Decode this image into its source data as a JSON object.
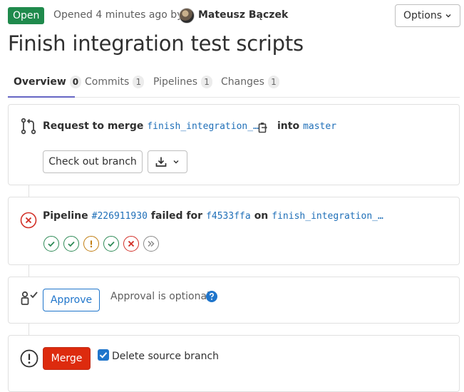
{
  "header": {
    "status": "Open",
    "opened_text": "Opened 4 minutes ago by",
    "author": "Mateusz Bączek",
    "options_label": "Options",
    "title": "Finish integration test scripts"
  },
  "tabs": [
    {
      "label": "Overview",
      "count": "0"
    },
    {
      "label": "Commits",
      "count": "1"
    },
    {
      "label": "Pipelines",
      "count": "1"
    },
    {
      "label": "Changes",
      "count": "1"
    }
  ],
  "merge_request": {
    "prefix": "Request to merge",
    "source_branch": "finish_integration_…",
    "into_label": "into",
    "target_branch": "master",
    "checkout_label": "Check out branch"
  },
  "pipeline": {
    "label": "Pipeline",
    "id": "#226911930",
    "status_text": "failed for",
    "commit": "f4533ffa",
    "on_label": "on",
    "branch": "finish_integration_…",
    "stages": [
      "success",
      "success",
      "warning",
      "success",
      "failed",
      "skipped"
    ]
  },
  "approval": {
    "approve_label": "Approve",
    "optional_text": "Approval is optional"
  },
  "merge": {
    "merge_label": "Merge",
    "delete_source_label": "Delete source branch",
    "delete_source_checked": true
  },
  "colors": {
    "open_badge": "#1f8a4c",
    "link": "#1f6fb8",
    "tab_active_underline": "#6666c4",
    "merge_button": "#dd2b0e",
    "success": "#2e8a56",
    "warning": "#c17d10",
    "failed": "#d22f27"
  }
}
